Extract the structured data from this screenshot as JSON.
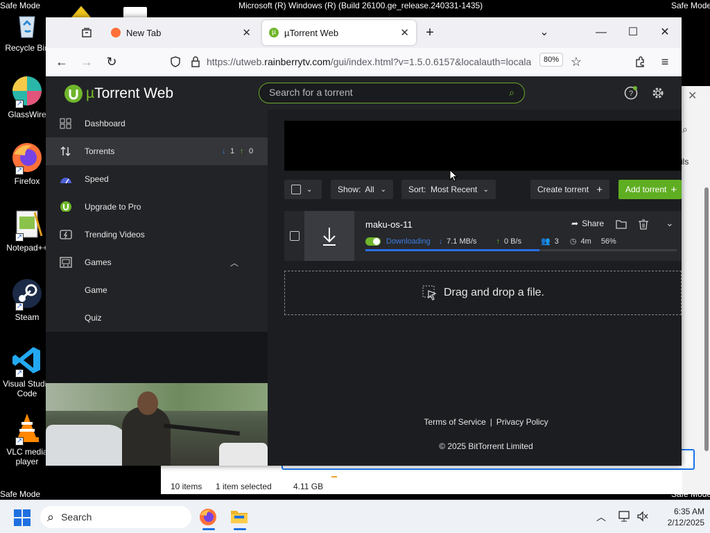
{
  "desktop": {
    "top_title": "Microsoft (R) Windows (R) (Build 26100.ge_release.240331-1435)",
    "safe_mode": "Safe Mode",
    "icons": [
      {
        "label": "Recycle Bin"
      },
      {
        "label": "GlassWire"
      },
      {
        "label": "Firefox"
      },
      {
        "label": "Notepad++"
      },
      {
        "label": "Steam"
      },
      {
        "label": "Visual Studio Code"
      },
      {
        "label": "VLC media player"
      }
    ]
  },
  "explorer": {
    "items": "10 items",
    "selected": "1 item selected",
    "size": "4.11 GB",
    "side_text": "ils"
  },
  "browser": {
    "tabs": [
      {
        "label": "New Tab"
      },
      {
        "label": "µTorrent Web"
      }
    ],
    "url_prefix": "https://utweb.",
    "url_host": "rainberrytv.com",
    "url_rest": "/gui/index.html?v=1.5.0.6157&localauth=locala",
    "zoom": "80%"
  },
  "app": {
    "logo_mu": "µ",
    "logo_text": "Torrent Web",
    "search_placeholder": "Search for a torrent",
    "sidebar": {
      "dashboard": "Dashboard",
      "torrents": "Torrents",
      "down_count": "1",
      "up_count": "0",
      "speed": "Speed",
      "upgrade": "Upgrade to Pro",
      "trending": "Trending Videos",
      "games": "Games",
      "game": "Game",
      "quiz": "Quiz"
    },
    "controls": {
      "show": "Show:  All",
      "sort": "Sort:  Most Recent",
      "create": "Create torrent",
      "add": "Add torrent"
    },
    "torrent": {
      "name": "maku-os-11",
      "share": "Share",
      "status": "Downloading",
      "down_speed": "7.1 MB/s",
      "up_speed": "0 B/s",
      "peers": "3",
      "eta": "4m",
      "percent": "56%",
      "progress": 0.56
    },
    "dropzone": "Drag and drop a file.",
    "footer": {
      "terms": "Terms of Service",
      "sep": "|",
      "privacy": "Privacy Policy",
      "copyright": "© 2025 BitTorrent Limited"
    }
  },
  "taskbar": {
    "search": "Search",
    "time": "6:35 AM",
    "date": "2/12/2025"
  },
  "colors": {
    "accent_green": "#6fb62c",
    "progress_blue": "#2a6fe8",
    "status_blue": "#3d7be0"
  }
}
